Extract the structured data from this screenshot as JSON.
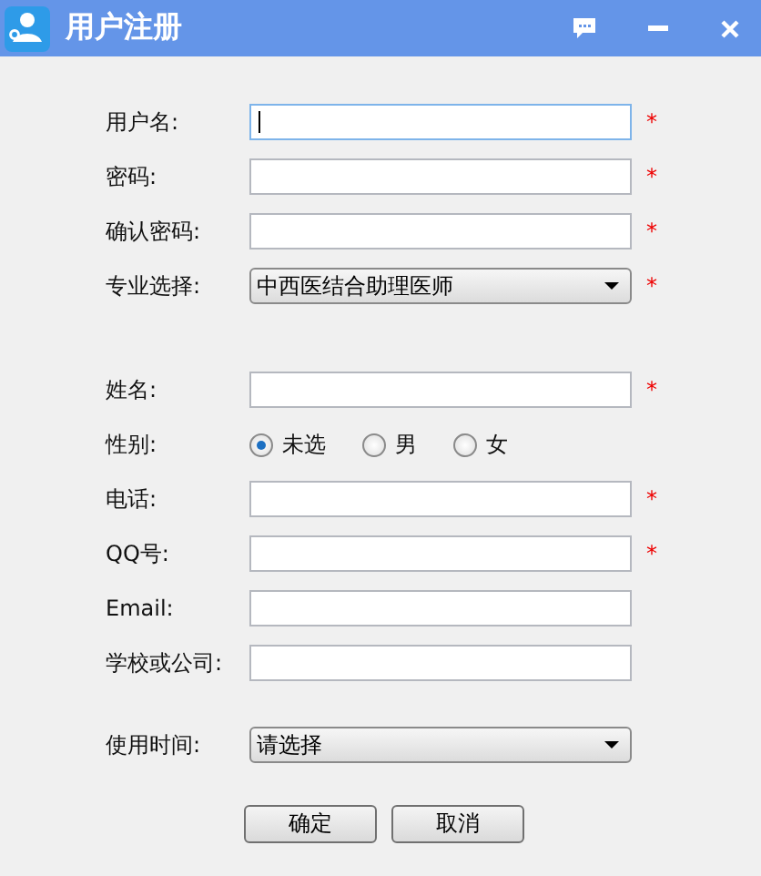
{
  "window": {
    "title": "用户注册"
  },
  "sections": [
    {
      "rows": [
        {
          "kind": "text",
          "label": "用户名:",
          "focused": true,
          "mark": "*"
        },
        {
          "kind": "text",
          "label": "密码:",
          "focused": false,
          "mark": "*"
        },
        {
          "kind": "text",
          "label": "确认密码:",
          "focused": false,
          "mark": "*"
        },
        {
          "kind": "select",
          "label": "专业选择:",
          "value": "中西医结合助理医师",
          "mark": "*"
        }
      ]
    },
    {
      "rows": [
        {
          "kind": "text",
          "label": "姓名:",
          "focused": false,
          "mark": "*"
        },
        {
          "kind": "radio",
          "label": "性别:",
          "options": [
            {
              "label": "未选",
              "selected": true
            },
            {
              "label": "男",
              "selected": false
            },
            {
              "label": "女",
              "selected": false
            }
          ]
        },
        {
          "kind": "text",
          "label": "电话:",
          "focused": false,
          "mark": "*"
        },
        {
          "kind": "text",
          "label": "QQ号:",
          "focused": false,
          "mark": "*"
        },
        {
          "kind": "text",
          "label": "Email:",
          "focused": false
        },
        {
          "kind": "text",
          "label": "学校或公司:",
          "focused": false
        }
      ]
    },
    {
      "rows": [
        {
          "kind": "select",
          "label": "使用时间:",
          "value": "请选择"
        }
      ]
    }
  ],
  "buttons": [
    "确定",
    "取消"
  ]
}
